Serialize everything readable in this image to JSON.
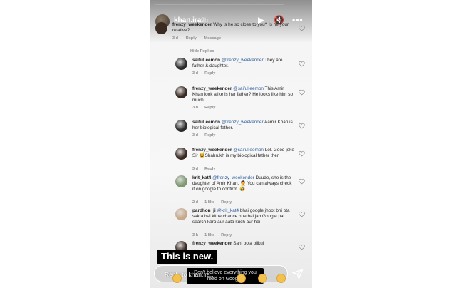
{
  "story": {
    "username": "khan.ira",
    "time": "9h",
    "progress": 0.85,
    "controls": {
      "play_icon": "▶",
      "mute_icon": "🔇",
      "more_icon": "•••"
    }
  },
  "top_comment": {
    "user": "frenzy_weekender",
    "text": "Why is he so close to you? Is he your relative?",
    "time": "3 d",
    "reply_label": "Reply",
    "message_label": "Message"
  },
  "hide_replies_label": "Hide Replies",
  "replies": [
    {
      "user": "saiful.eemon",
      "mention": "@frenzy_weekender",
      "text": "They are father & daughter.",
      "time": "3 d",
      "likes": "",
      "reply_label": "Reply",
      "avatar_color": "#2b2b2b"
    },
    {
      "user": "frenzy_weekender",
      "mention": "@saiful.eemon",
      "text": "This Amir Khan look alike is her father? He looks like him so much",
      "time": "3 d",
      "likes": "",
      "reply_label": "Reply",
      "avatar_color": "#3b2a22"
    },
    {
      "user": "saiful.eemon",
      "mention": "@frenzy_weekender",
      "text": "Aamir Khan is her biological father.",
      "time": "3 d",
      "likes": "",
      "reply_label": "Reply",
      "avatar_color": "#2b2b2b"
    },
    {
      "user": "frenzy_weekender",
      "mention": "@saiful.eemon",
      "text": "Lol. Good joke Sir 😂Shahrukh is my biological father then",
      "time": "3 d",
      "likes": "",
      "reply_label": "Reply",
      "avatar_color": "#3b2a22"
    },
    {
      "user": "krit_kat4",
      "mention": "@frenzy_weekender",
      "text": "Duude, she is the daughter of Amir Khan. 🤦 You can always check it on google to confirm. 🤣",
      "time": "2 d",
      "likes": "1 like",
      "reply_label": "Reply",
      "avatar_color": "#7f9a72"
    },
    {
      "user": "pardhon_ji",
      "mention": "@krit_kat4",
      "text": "bhai google jhoot bhi bta sakta hai kitne chance hue hai jab Google par search karo aur aata kuch aur hai",
      "time": "3 h",
      "likes": "1 like",
      "reply_label": "Reply",
      "avatar_color": "#c9a98a"
    },
    {
      "user": "frenzy_weekender",
      "mention": "",
      "text": "Sahi bola bilkul",
      "time": "",
      "likes": "",
      "reply_label": "",
      "avatar_color": "#3b2a22"
    }
  ],
  "captions": {
    "line1": "This is new.",
    "line2": "Don't believe everything you read on Google."
  },
  "reply_bar": {
    "placeholder": "Reply to khan.ira...",
    "message_partial": "Message"
  },
  "icons": {
    "heart": "heart-icon",
    "send": "send-icon",
    "emoji": "emoji-icon"
  }
}
